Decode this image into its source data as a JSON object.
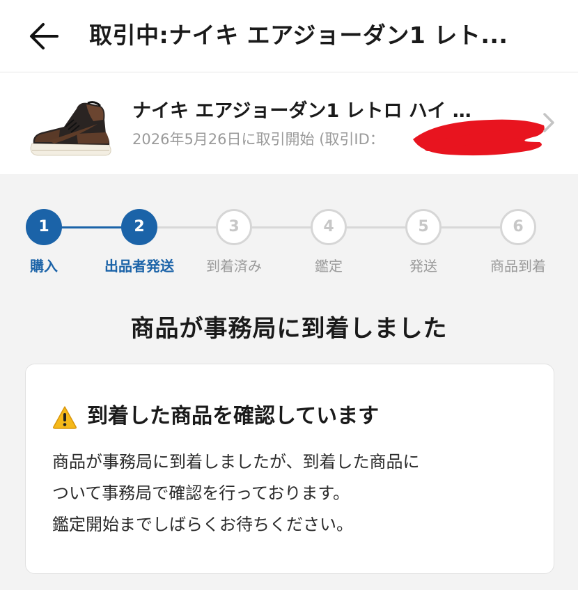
{
  "header": {
    "title": "取引中:ナイキ エアジョーダン1 レト..."
  },
  "product": {
    "name": "ナイキ エアジョーダン1 レトロ ハイ …",
    "meta": "2026年5月26日に取引開始 (取引ID：",
    "image_description": "sneaker-thumbnail"
  },
  "steps": [
    {
      "number": "1",
      "label": "購入",
      "state": "active"
    },
    {
      "number": "2",
      "label": "出品者発送",
      "state": "active"
    },
    {
      "number": "3",
      "label": "到着済み",
      "state": "inactive"
    },
    {
      "number": "4",
      "label": "鑑定",
      "state": "inactive"
    },
    {
      "number": "5",
      "label": "発送",
      "state": "inactive"
    },
    {
      "number": "6",
      "label": "商品到着",
      "state": "inactive"
    }
  ],
  "status": {
    "title": "商品が事務局に到着しました"
  },
  "notice": {
    "icon": "warning-icon",
    "title": "到着した商品を確認しています",
    "lines": [
      "商品が事務局に到着しましたが、到着した商品に",
      "ついて事務局で確認を行っております。",
      "鑑定開始までしばらくお待ちください。"
    ]
  },
  "colors": {
    "accent": "#1b63a8",
    "inactive": "#d6d6d6",
    "redaction": "#e8141f",
    "warning": "#f5b91a"
  }
}
